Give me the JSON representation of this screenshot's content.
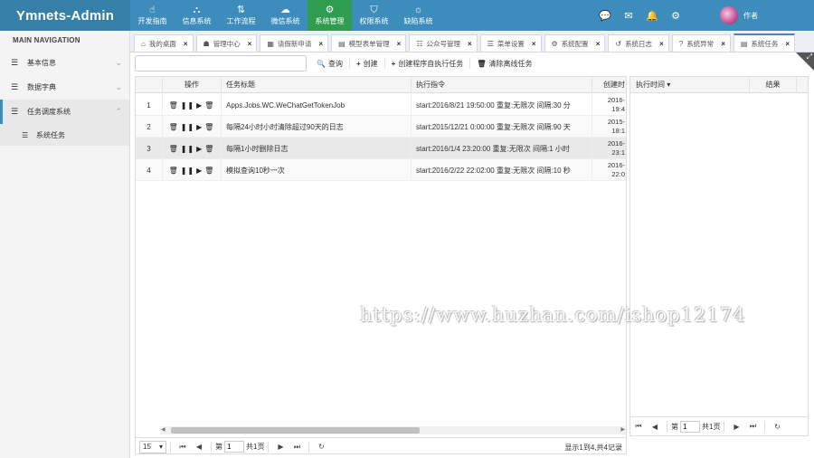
{
  "app": {
    "brand": "Ymnets-Admin"
  },
  "modules": [
    {
      "label": "开发指南",
      "icon": "pointer-hand-icon",
      "glyph": "☝"
    },
    {
      "label": "信息系统",
      "icon": "sitemap-icon",
      "glyph": "⛬"
    },
    {
      "label": "工作流程",
      "icon": "sort-order-icon",
      "glyph": "⇅"
    },
    {
      "label": "微信系统",
      "icon": "wechat-icon",
      "glyph": "☁"
    },
    {
      "label": "系统管理",
      "icon": "gears-icon",
      "glyph": "⚙"
    },
    {
      "label": "权限系统",
      "icon": "shield-icon",
      "glyph": "⛉"
    },
    {
      "label": "缺陷系统",
      "icon": "bug-icon",
      "glyph": "☼"
    }
  ],
  "top_right": {
    "icons": [
      {
        "icon": "chat-bubble-icon",
        "glyph": "💬"
      },
      {
        "icon": "envelope-icon",
        "glyph": "✉"
      },
      {
        "icon": "bell-icon",
        "glyph": "🔔"
      },
      {
        "icon": "gears-icon",
        "glyph": "⚙"
      }
    ],
    "user_name": "作者"
  },
  "sidebar": {
    "header": "MAIN NAVIGATION",
    "items": [
      {
        "label": "基本信息"
      },
      {
        "label": "数据字典"
      },
      {
        "label": "任务调度系统"
      }
    ],
    "sub_items": [
      {
        "label": "系统任务"
      }
    ]
  },
  "tabs": [
    {
      "label": "我的桌面",
      "glyph": "⌂"
    },
    {
      "label": "管理中心",
      "glyph": "☗"
    },
    {
      "label": "请假新申请",
      "glyph": "▦"
    },
    {
      "label": "模型表单管理",
      "glyph": "▤"
    },
    {
      "label": "公众号管理",
      "glyph": "☷"
    },
    {
      "label": "菜单设置",
      "glyph": "☰"
    },
    {
      "label": "系统配置",
      "glyph": "⚙"
    },
    {
      "label": "系统日志",
      "glyph": "↺"
    },
    {
      "label": "系统异常",
      "glyph": "?"
    },
    {
      "label": "系统任务",
      "glyph": "▤"
    }
  ],
  "tab_close": "×",
  "toolbar": {
    "search_placeholder": "",
    "buttons": [
      {
        "label": "查询",
        "glyph": "🔍"
      },
      {
        "label": "创建",
        "glyph": "+"
      },
      {
        "label": "创建程序自执行任务",
        "glyph": "+"
      },
      {
        "label": "清除离线任务",
        "glyph": "🗑"
      }
    ]
  },
  "grid": {
    "columns": [
      "",
      "操作",
      "任务标题",
      "执行指令",
      "创建时"
    ],
    "op_glyphs": [
      "🗑",
      "❚❚",
      "▶",
      "🗑"
    ],
    "rows": [
      {
        "num": "1",
        "title": "Apps.Jobs.WC.WeChatGetTokenJob",
        "command": "start:2016/8/21 19:50:00 重复:无限次 间隔:30 分",
        "created_1": "2016-",
        "created_2": "19:4"
      },
      {
        "num": "2",
        "title": "每隔24小时小时清除超过90天的日志",
        "command": "start:2015/12/21 0:00:00 重复:无限次 间隔:90 天",
        "created_1": "2015-",
        "created_2": "18:1"
      },
      {
        "num": "3",
        "title": "每隔1小时删除日志",
        "command": "start:2016/1/4 23:20:00 重复:无限次 间隔:1 小时",
        "created_1": "2016-",
        "created_2": "23:1"
      },
      {
        "num": "4",
        "title": "模拟查询10秒一次",
        "command": "start:2016/2/22 22:02:00 重复:无限次 间隔:10 秒",
        "created_1": "2016-",
        "created_2": "22:0"
      }
    ],
    "selected_row": 3
  },
  "pager": {
    "page_size": "15",
    "page_label": "第",
    "page_value": "1",
    "total_pages": "共1页",
    "info": "显示1到4,共4记录"
  },
  "log_grid": {
    "columns": [
      "执行时间 ▾",
      "结果"
    ]
  },
  "log_pager": {
    "page_label": "第",
    "page_value": "1",
    "total_pages": "共1页"
  },
  "watermark": "https://www.huzhan.com/ishop12174"
}
